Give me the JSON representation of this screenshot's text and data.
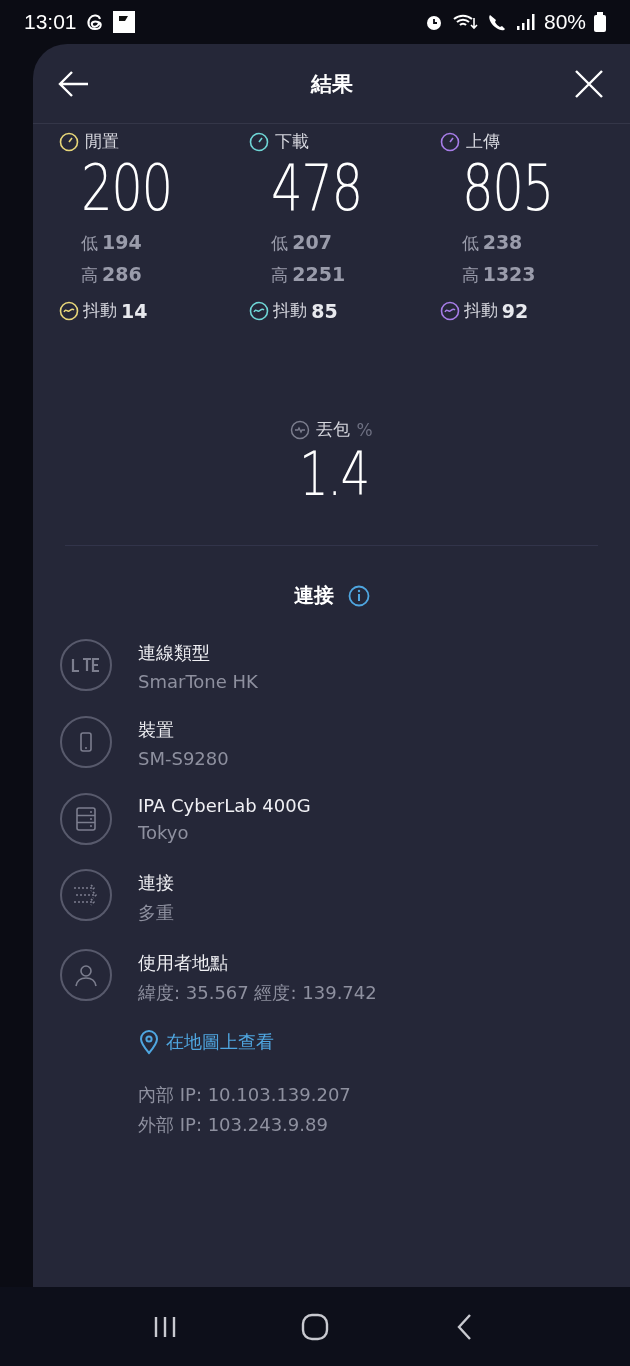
{
  "status_bar": {
    "time": "13:01",
    "battery": "80%"
  },
  "header": {
    "title": "結果"
  },
  "metrics": [
    {
      "label": "閒置",
      "value": "200",
      "low_label": "低",
      "low": "194",
      "high_label": "高",
      "high": "286",
      "jitter_label": "抖動",
      "jitter": "14",
      "color": "#e8d77a"
    },
    {
      "label": "下載",
      "value": "478",
      "low_label": "低",
      "low": "207",
      "high_label": "高",
      "high": "2251",
      "jitter_label": "抖動",
      "jitter": "85",
      "color": "#6fd6d6"
    },
    {
      "label": "上傳",
      "value": "805",
      "low_label": "低",
      "low": "238",
      "high_label": "高",
      "high": "1323",
      "jitter_label": "抖動",
      "jitter": "92",
      "color": "#a77de8"
    }
  ],
  "packet_loss": {
    "label": "丟包",
    "unit": "%",
    "value": "1.4"
  },
  "connection": {
    "title": "連接",
    "items": [
      {
        "kind": "lte",
        "label": "連線類型",
        "value": "SmarTone HK"
      },
      {
        "kind": "device",
        "label": "裝置",
        "value": "SM-S9280"
      },
      {
        "kind": "server",
        "label": "IPA CyberLab 400G",
        "value": "Tokyo"
      },
      {
        "kind": "multi",
        "label": "連接",
        "value": "多重"
      },
      {
        "kind": "user",
        "label": "使用者地點",
        "value": "緯度: 35.567 經度: 139.742",
        "link": "在地圖上查看",
        "lines": [
          "內部 IP: 10.103.139.207",
          "外部 IP: 103.243.9.89"
        ]
      }
    ]
  }
}
